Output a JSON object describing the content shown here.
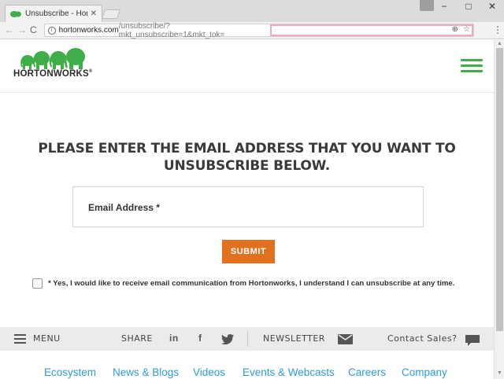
{
  "browser": {
    "tab_title": "Unsubscribe - Hortonwo",
    "tab_close": "✕",
    "window_minimize": "−",
    "window_maximize": "□",
    "window_close": "✕",
    "url_host": "hortonworks.com",
    "url_path": "/unsubscribe/?mkt_unsubscribe=1&mkt_tok=",
    "back_icon": "←",
    "forward_icon": "→",
    "reload_icon": "C",
    "zoom_icon": "⊕",
    "star_icon": "☆",
    "menu_icon": "⋮"
  },
  "header": {
    "logo_text": "HORTONWORKS",
    "logo_mark": "®",
    "brand_color": "#3fae49"
  },
  "main": {
    "heading_line1": "PLEASE ENTER THE EMAIL ADDRESS THAT YOU WANT TO",
    "heading_line2": "UNSUBSCRIBE BELOW.",
    "email_label": "Email Address *",
    "submit_label": "SUBMIT",
    "submit_color": "#e1701f",
    "consent_text": "* Yes, I would like to receive email communication from Hortonworks, I understand I can unsubscribe at any time."
  },
  "footer_bar": {
    "menu_label": "MENU",
    "share_label": "SHARE",
    "linkedin_icon": "in",
    "facebook_icon": "f",
    "newsletter_label": "NEWSLETTER",
    "contact_label": "Contact Sales?"
  },
  "footer_links": [
    "Ecosystem",
    "News & Blogs",
    "Videos",
    "Events & Webcasts",
    "Careers",
    "Company"
  ],
  "link_color": "#2e9cd4"
}
